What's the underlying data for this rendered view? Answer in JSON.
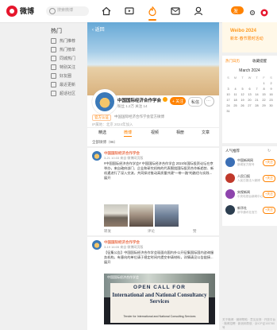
{
  "app": {
    "logo_text": "微博",
    "search_placeholder": "搜索微博"
  },
  "topnav": {
    "icons": [
      "home-icon",
      "video-icon",
      "discover-icon",
      "message-icon",
      "profile-icon"
    ],
    "active": "discover-icon",
    "accent": "#ff8200",
    "pill_label": "发"
  },
  "leftnav": {
    "header": "热门",
    "items": [
      "热门推荐",
      "热门榜单",
      "同城热门",
      "特别关注",
      "好友圈",
      "最近更新",
      "超话社区"
    ]
  },
  "banner": {
    "back_label": "‹ 返回"
  },
  "profile": {
    "name": "中国国际经济合作学会",
    "stats": "粉丝 1.2万   关注 14",
    "follow_label": "+ 关注",
    "message_label": "私信",
    "more_label": "···",
    "tag": "官方认证",
    "tagline": "中国国际经济合作学会官方微博",
    "location": "IP属地：北京   2024年加入"
  },
  "tabs": [
    "精选",
    "微博",
    "视频",
    "相册",
    "文章"
  ],
  "active_tab": "微博",
  "post_count_label": "全部微博（96）",
  "posts": [
    {
      "author": "中国国际经济合作学会",
      "time": "3-21 10:33  来自 微博网页版",
      "text": "#中国国际经济合作学会# 中国国际经济合作学会 2024年国际投资论坛在京举办，来自政府部门、企业和研究机构的代表围绕国际投资合作新趋势、新机遇进行了深入交流，共同探讨推动高质量共建“一带一路”的路径与实践...展开",
      "actions": {
        "share": "转发",
        "comment": "评论",
        "like": "赞"
      }
    },
    {
      "author": "中国国际经济合作学会",
      "time": "3-19 16:05  来自 微博网页版",
      "text": "【征集公告】中国国际经济合作学会现面向国内外公开征集国际国内咨询服务机构，有意向的单位请于规定时间内提交申请材料，详情请见公告链接...展开",
      "image": {
        "brand": "中国国际经济合作学会",
        "line1": "OPEN CALL FOR",
        "line2": "International and National Consultancy Services",
        "line3": "Tender for International and National Consulting Services"
      }
    }
  ],
  "sidebar": {
    "ad": {
      "title": "Weibo 2024",
      "subtitle": "新年·春节限时活动"
    },
    "calendar": {
      "tabs": [
        "热门日历",
        "收藏提醒"
      ],
      "month": "March 2024",
      "weekdays": [
        "S",
        "M",
        "T",
        "W",
        "T",
        "F",
        "S"
      ],
      "days": [
        "",
        "",
        "",
        "",
        "",
        "1",
        "2",
        "3",
        "4",
        "5",
        "6",
        "7",
        "8",
        "9",
        "10",
        "11",
        "12",
        "13",
        "14",
        "15",
        "16",
        "17",
        "18",
        "19",
        "20",
        "21",
        "22",
        "23",
        "24",
        "25",
        "26",
        "27",
        "28",
        "29",
        "30",
        "31",
        "",
        "",
        "",
        "",
        "",
        ""
      ]
    },
    "hot": {
      "header": "人气推荐",
      "refresh": "↻",
      "rows": [
        {
          "name": "中国新闻网",
          "desc": "新闻官方账号",
          "follow": "+关注"
        },
        {
          "name": "人民日报",
          "desc": "人民日报法人微博",
          "follow": "+关注"
        },
        {
          "name": "央视新闻",
          "desc": "中央电视台新闻中心",
          "follow": "+关注"
        },
        {
          "name": "新华社",
          "desc": "新华通讯社官方",
          "follow": "+关注"
        }
      ]
    },
    "footer": "关于微博 · 微博帮助 · 意见反馈 · 开放平台 · 微博招聘 · 新浪网导航 · 京ICP证100780号"
  }
}
